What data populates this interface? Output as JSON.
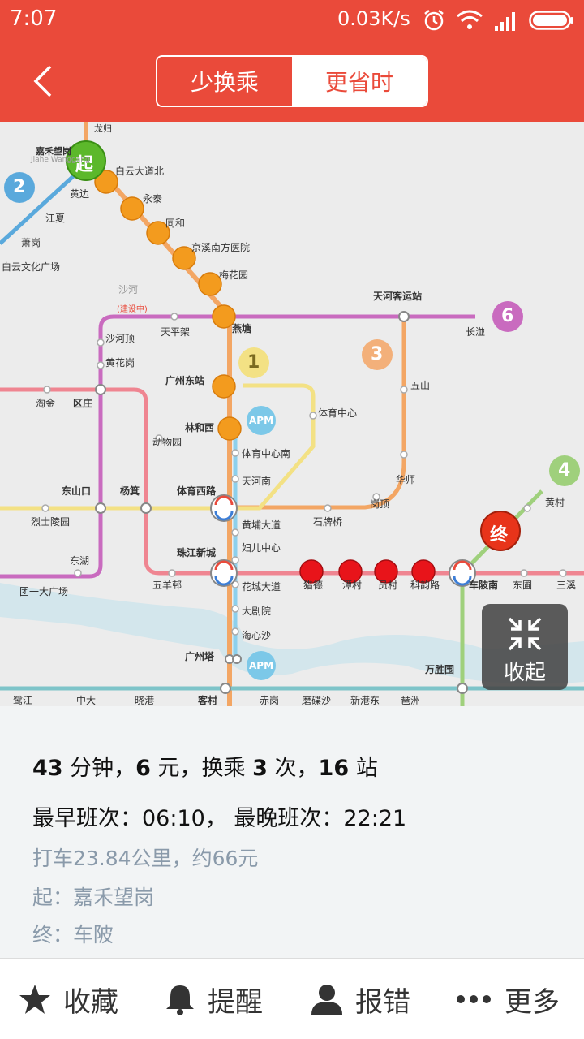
{
  "status": {
    "time": "7:07",
    "speed": "0.03K/s"
  },
  "header": {
    "tab_transfer": "少换乘",
    "tab_time": "更省时"
  },
  "map": {
    "labels": {
      "longgui": "龙归",
      "jiahewanggang": "嘉禾望岗",
      "jiahe_en": "Jiahe Wanggang",
      "huangbian": "黄边",
      "jiangxia": "江夏",
      "xiaoping": "萧岗",
      "baiyun_culture": "白云文化广场",
      "baiyun_dadaobei": "白云大道北",
      "yongtai": "永泰",
      "tonghe": "同和",
      "jingxi": "京溪南方医院",
      "meihuayuan": "梅花园",
      "shahe": "沙河",
      "shahe_note": "(建设中)",
      "yantang": "燕塘",
      "tianpingjia": "天平架",
      "shahe_ding": "沙河顶",
      "huanghuagang": "黄花岗",
      "guangzhou_east": "广州东站",
      "linhexi": "林和西",
      "dongwuyuan": "动物园",
      "tianhe_coach": "天河客运站",
      "changban": "长湴",
      "tiyuzhongxin": "体育中心",
      "tiyuzhongxinnan": "体育中心南",
      "tianhenan": "天河南",
      "tiyuxilu": "体育西路",
      "wushan": "五山",
      "huashi": "华师",
      "gangding": "岗顶",
      "shipaiqiao": "石牌桥",
      "huangpu_dadao": "黄埔大道",
      "funv": "妇儿中心",
      "huacheng": "花城大道",
      "dajuyuan": "大剧院",
      "haixinsha": "海心沙",
      "guangzhouta": "广州塔",
      "zhujiang_xincheng": "珠江新城",
      "wuyangcun": "五羊邨",
      "dongshankou": "东山口",
      "yangji": "杨箕",
      "liesheng": "烈士陵园",
      "dongxiao": "东湖",
      "tuanyi": "团一大广场",
      "taojin": "淘金",
      "quzhuang": "区庄",
      "liede": "猎德",
      "tancun": "潭村",
      "yuancun": "员村",
      "kecun_lu": "科韵路",
      "chebeinan": "车陂南",
      "dongpu": "东圃",
      "sanxi": "三溪",
      "wanshengwei": "万胜围",
      "huangcun": "黄村",
      "kecun": "客村",
      "chigang": "赤岗",
      "mozhousha": "磨碟沙",
      "xingangdong": "新港东",
      "pazhou": "琶洲",
      "zhongda": "中大",
      "lujiang": "鹭江",
      "xiaogang": "晓港",
      "apm": "APM",
      "apm2": "APM",
      "line1": "1",
      "line2": "2",
      "line3": "3",
      "line4": "4",
      "line6": "6",
      "start_marker": "起",
      "end_marker": "终"
    },
    "collapse_label": "收起"
  },
  "summary": {
    "minutes": "43",
    "minutes_unit": " 分钟，",
    "fare": "6",
    "fare_unit": " 元，换乘 ",
    "transfers": "3",
    "transfers_unit": " 次，",
    "stations": "16",
    "stations_unit": " 站",
    "schedule": "最早班次：06:10， 最晚班次：22:21",
    "taxi": "打车23.84公里，约66元",
    "start": "起：嘉禾望岗",
    "end": "终：车陂"
  },
  "bottom": {
    "favorite": "收藏",
    "remind": "提醒",
    "report": "报错",
    "more": "更多"
  },
  "colors": {
    "accent": "#ea4a3a",
    "route": "#f39b1e",
    "line5": "#e84c5a"
  }
}
